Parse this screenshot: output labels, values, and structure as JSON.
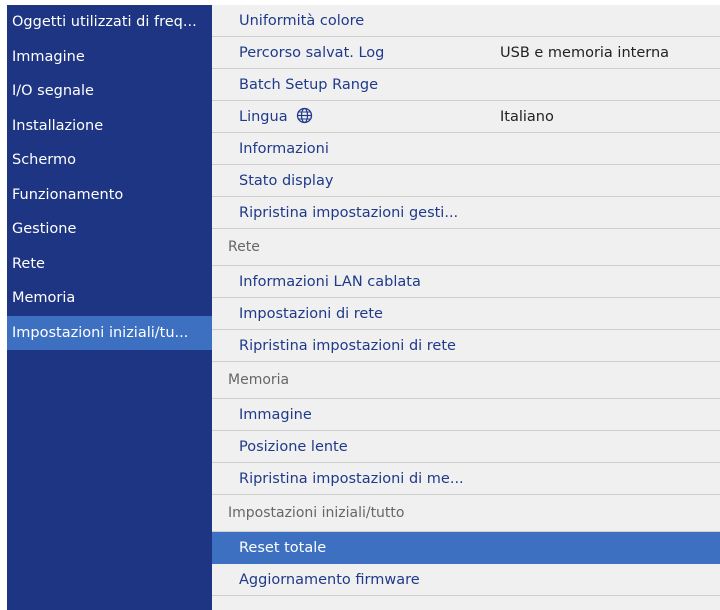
{
  "sidebar": {
    "items": [
      {
        "label": "Oggetti utilizzati di freq..."
      },
      {
        "label": "Immagine"
      },
      {
        "label": "I/O segnale"
      },
      {
        "label": "Installazione"
      },
      {
        "label": "Schermo"
      },
      {
        "label": "Funzionamento"
      },
      {
        "label": "Gestione"
      },
      {
        "label": "Rete"
      },
      {
        "label": "Memoria"
      },
      {
        "label": "Impostazioni iniziali/tu..."
      }
    ],
    "selected_index": 9
  },
  "panel": {
    "items": [
      {
        "label": "Uniformità colore"
      },
      {
        "label": "Percorso salvat. Log",
        "value": "USB e memoria interna"
      },
      {
        "label": "Batch Setup Range"
      },
      {
        "label": "Lingua",
        "icon": "globe-icon",
        "value": "Italiano"
      },
      {
        "label": "Informazioni"
      },
      {
        "label": "Stato display"
      },
      {
        "label": "Ripristina impostazioni gesti..."
      }
    ],
    "rete": {
      "header": "Rete",
      "items": [
        {
          "label": "Informazioni LAN cablata"
        },
        {
          "label": "Impostazioni di rete"
        },
        {
          "label": "Ripristina impostazioni di rete"
        }
      ]
    },
    "memoria": {
      "header": "Memoria",
      "items": [
        {
          "label": "Immagine"
        },
        {
          "label": "Posizione lente"
        },
        {
          "label": "Ripristina impostazioni di me..."
        }
      ]
    },
    "iniziali": {
      "header": "Impostazioni iniziali/tutto",
      "items": [
        {
          "label": "Reset totale",
          "selected": true
        },
        {
          "label": "Aggiornamento firmware"
        }
      ]
    }
  },
  "colors": {
    "sidebar_bg": "#1d3582",
    "selected_bg": "#3e70c2",
    "panel_bg": "#f0f0f0",
    "item_text": "#1f3a8a"
  }
}
